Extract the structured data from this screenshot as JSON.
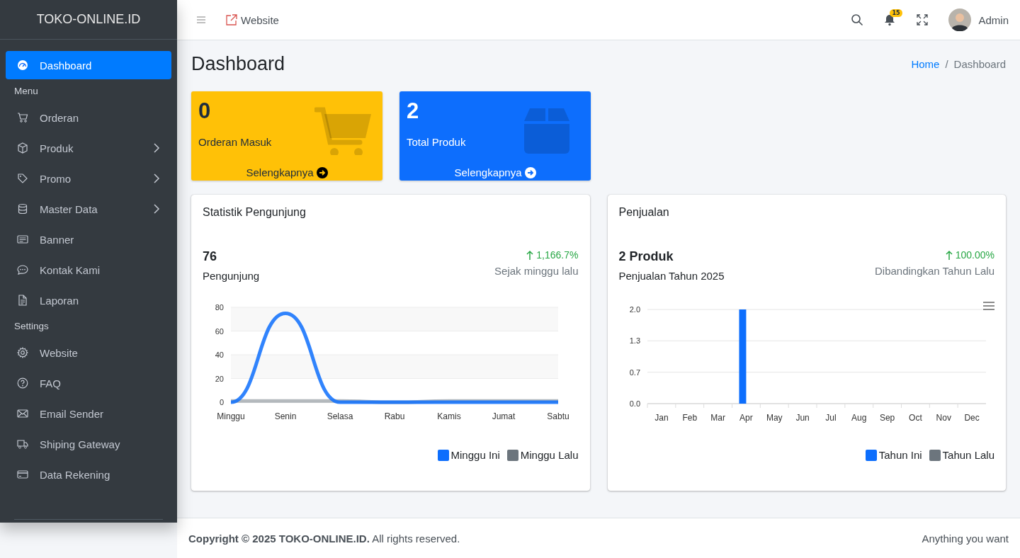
{
  "brand": "TOKO-ONLINE.ID",
  "sidebar": {
    "items": [
      {
        "kind": "item",
        "label": "Dashboard",
        "submenu": false,
        "selected": true
      },
      {
        "kind": "header",
        "label": "Menu"
      },
      {
        "kind": "item",
        "label": "Orderan",
        "submenu": false,
        "selected": false
      },
      {
        "kind": "item",
        "label": "Produk",
        "submenu": true,
        "selected": false
      },
      {
        "kind": "item",
        "label": "Promo",
        "submenu": true,
        "selected": false
      },
      {
        "kind": "item",
        "label": "Master Data",
        "submenu": true,
        "selected": false
      },
      {
        "kind": "item",
        "label": "Banner",
        "submenu": false,
        "selected": false
      },
      {
        "kind": "item",
        "label": "Kontak Kami",
        "submenu": false,
        "selected": false
      },
      {
        "kind": "item",
        "label": "Laporan",
        "submenu": false,
        "selected": false
      },
      {
        "kind": "header",
        "label": "Settings"
      },
      {
        "kind": "item",
        "label": "Website",
        "submenu": false,
        "selected": false
      },
      {
        "kind": "item",
        "label": "FAQ",
        "submenu": false,
        "selected": false
      },
      {
        "kind": "item",
        "label": "Email Sender",
        "submenu": false,
        "selected": false
      },
      {
        "kind": "item",
        "label": "Shiping Gateway",
        "submenu": false,
        "selected": false
      },
      {
        "kind": "item",
        "label": "Data Rekening",
        "submenu": false,
        "selected": false
      }
    ]
  },
  "topbar": {
    "link": "Website",
    "notification_count": "15",
    "user": "Admin"
  },
  "page": {
    "title": "Dashboard",
    "breadcrumb_separator": "/",
    "breadcrumb": [
      {
        "label": "Home",
        "kind": "link"
      },
      {
        "label": "Dashboard",
        "kind": "current"
      }
    ]
  },
  "small_boxes": [
    {
      "value": "0",
      "label": "Orderan Masuk",
      "link": "Selengkapnya",
      "color": "#ffc107"
    },
    {
      "value": "2",
      "label": "Total Produk",
      "link": "Selengkapnya",
      "color": "#0d6efd"
    }
  ],
  "cards": [
    {
      "title": "Statistik Pengunjung",
      "big": "76",
      "big_label": "Pengunjung",
      "change": "1,166.7%",
      "change_label": "Sejak minggu lalu",
      "chart_data": {
        "type": "line",
        "categories": [
          "Minggu",
          "Senin",
          "Selasa",
          "Rabu",
          "Kamis",
          "Jumat",
          "Sabtu"
        ],
        "series": [
          {
            "name": "Minggu Ini",
            "color": "#0d6efd",
            "values": [
              0,
              75,
              0,
              0,
              0,
              0,
              0
            ]
          },
          {
            "name": "Minggu Lalu",
            "color": "#6c757d",
            "values": [
              1,
              1,
              1,
              0,
              1,
              1,
              1
            ]
          }
        ],
        "ylim": [
          0,
          80
        ],
        "yticks": [
          0,
          20,
          40,
          60,
          80
        ],
        "grid": true
      }
    },
    {
      "title": "Penjualan",
      "big": "2 Produk",
      "big_label": "Penjualan Tahun 2025",
      "change": "100.00%",
      "change_label": "Dibandingkan Tahun Lalu",
      "chart_data": {
        "type": "bar",
        "categories": [
          "Jan",
          "Feb",
          "Mar",
          "Apr",
          "May",
          "Jun",
          "Jul",
          "Aug",
          "Sep",
          "Oct",
          "Nov",
          "Dec"
        ],
        "series": [
          {
            "name": "Tahun Ini",
            "color": "#0d6efd",
            "values": [
              0,
              0,
              0,
              2,
              0,
              0,
              0,
              0,
              0,
              0,
              0,
              0
            ]
          },
          {
            "name": "Tahun Lalu",
            "color": "#6c757d",
            "values": [
              0,
              0,
              0,
              0,
              0,
              0,
              0,
              0,
              0,
              0,
              0,
              0
            ]
          }
        ],
        "ylim": [
          0,
          2
        ],
        "grid": true,
        "yticks": [
          {
            "value": 0,
            "label": "0.0"
          },
          {
            "value": 0.667,
            "label": "0.7"
          },
          {
            "value": 1.333,
            "label": "1.3"
          },
          {
            "value": 2,
            "label": "2.0"
          }
        ]
      }
    }
  ],
  "footer": {
    "copyright": "**Copyright © 2025  TOKO-ONLINE.ID.** All rights reserved.",
    "right": "Anything you want"
  }
}
